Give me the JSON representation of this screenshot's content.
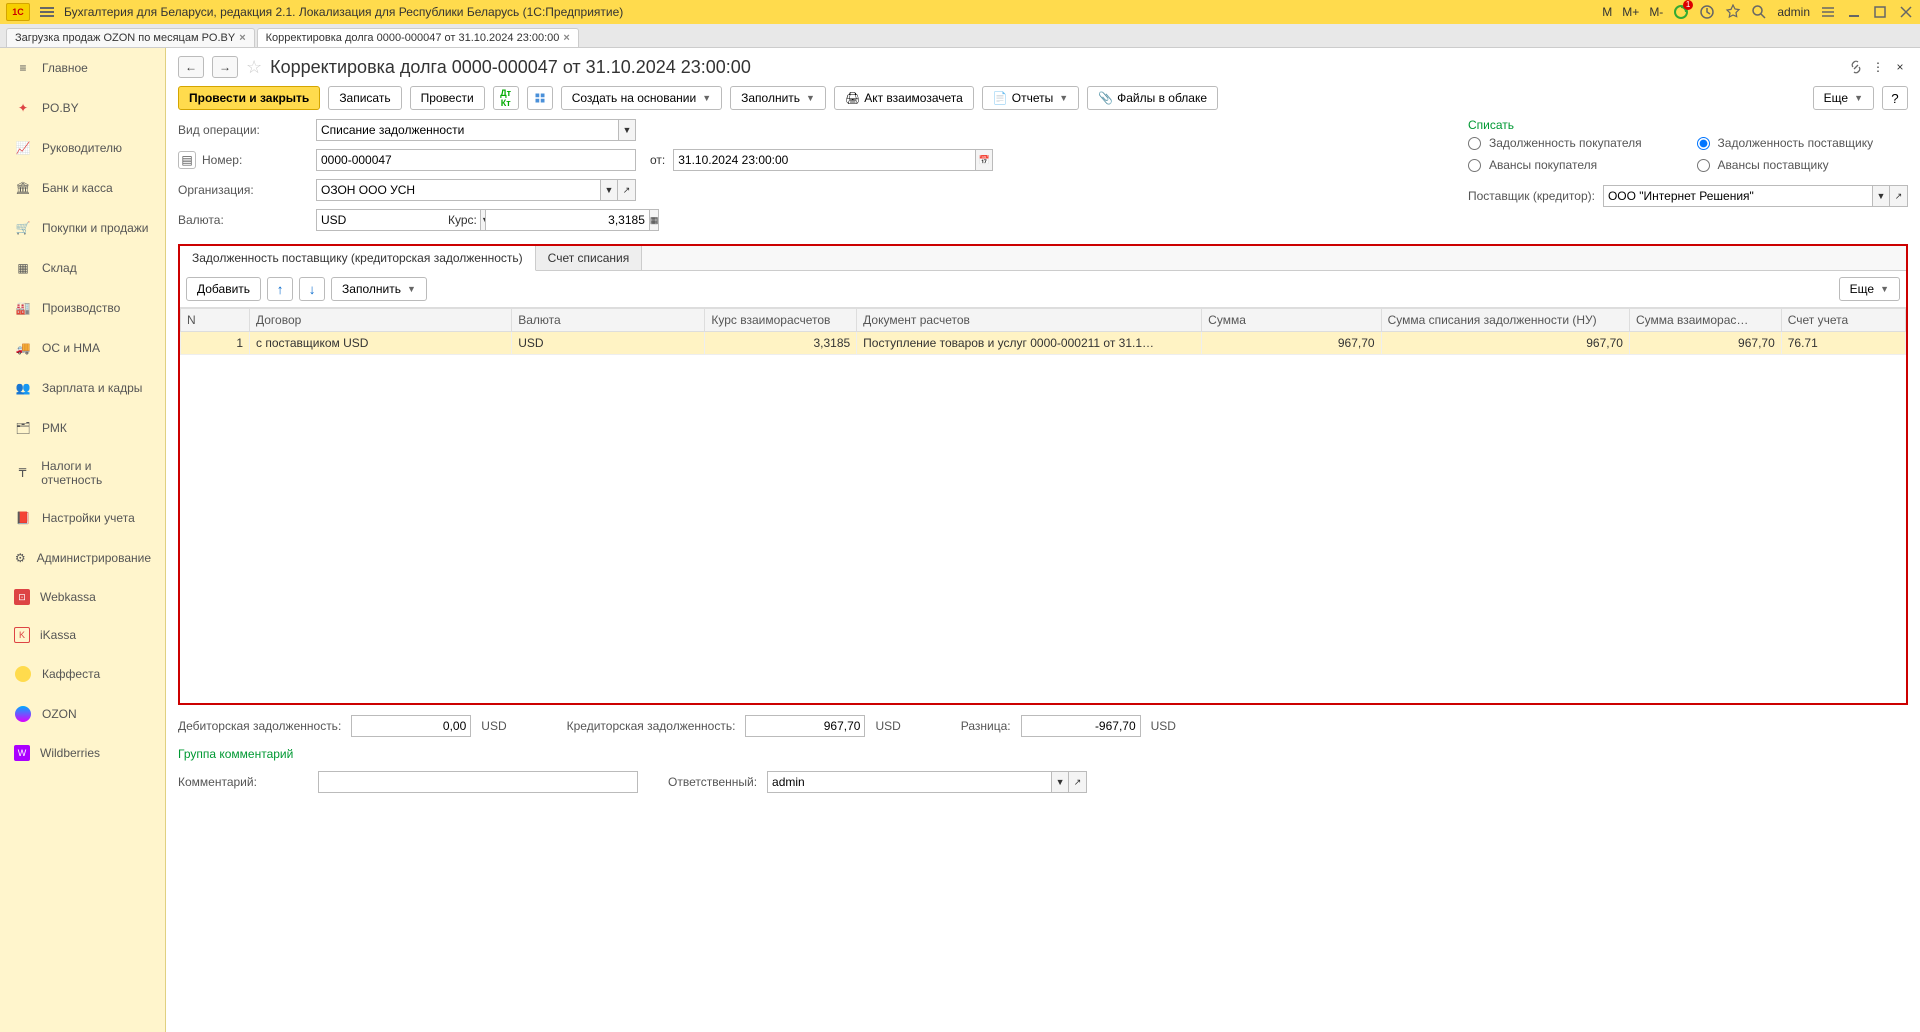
{
  "app_title": "Бухгалтерия для Беларуси, редакция 2.1. Локализация для Республики Беларусь   (1С:Предприятие)",
  "top_user": "admin",
  "top_labels": {
    "m": "M",
    "mplus": "M+",
    "mminus": "M-"
  },
  "tabs": [
    {
      "label": "Загрузка продаж OZON по месяцам PO.BY"
    },
    {
      "label": "Корректировка долга 0000-000047 от 31.10.2024 23:00:00"
    }
  ],
  "sidebar": [
    {
      "label": "Главное",
      "icon": "star"
    },
    {
      "label": "PO.BY",
      "icon": "flash"
    },
    {
      "label": "Руководителю",
      "icon": "chart"
    },
    {
      "label": "Банк и касса",
      "icon": "bank"
    },
    {
      "label": "Покупки и продажи",
      "icon": "cart"
    },
    {
      "label": "Склад",
      "icon": "boxes"
    },
    {
      "label": "Производство",
      "icon": "factory"
    },
    {
      "label": "ОС и НМА",
      "icon": "truck"
    },
    {
      "label": "Зарплата и кадры",
      "icon": "people"
    },
    {
      "label": "РМК",
      "icon": "rmk"
    },
    {
      "label": "Налоги и отчетность",
      "icon": "tax"
    },
    {
      "label": "Настройки учета",
      "icon": "book"
    },
    {
      "label": "Администрирование",
      "icon": "gear"
    },
    {
      "label": "Webkassa",
      "icon": "wk"
    },
    {
      "label": "iKassa",
      "icon": "ik"
    },
    {
      "label": "Каффеста",
      "icon": "kf"
    },
    {
      "label": "OZON",
      "icon": "oz"
    },
    {
      "label": "Wildberries",
      "icon": "wb"
    }
  ],
  "page_title": "Корректировка долга 0000-000047 от 31.10.2024 23:00:00",
  "toolbar": {
    "post_close": "Провести и закрыть",
    "save": "Записать",
    "post": "Провести",
    "create_based": "Создать на основании",
    "fill": "Заполнить",
    "act": "Акт взаимозачета",
    "reports": "Отчеты",
    "files": "Файлы в облаке",
    "more": "Еще"
  },
  "form": {
    "op_label": "Вид операции:",
    "op_value": "Списание задолженности",
    "num_label": "Номер:",
    "num_value": "0000-000047",
    "date_label": "от:",
    "date_value": "31.10.2024 23:00:00",
    "org_label": "Организация:",
    "org_value": "ОЗОН ООО УСН",
    "cur_label": "Валюта:",
    "cur_value": "USD",
    "rate_label": "Курс:",
    "rate_value": "3,3185"
  },
  "writeoff": {
    "title": "Списать",
    "r1": "Задолженность покупателя",
    "r2": "Задолженность поставщику",
    "r3": "Авансы покупателя",
    "r4": "Авансы поставщику",
    "supplier_label": "Поставщик (кредитор):",
    "supplier_value": "ООО \"Интернет Решения\""
  },
  "dtabs": {
    "t1": "Задолженность поставщику (кредиторская задолженность)",
    "t2": "Счет списания"
  },
  "dtoolbar": {
    "add": "Добавить",
    "fill": "Заполнить",
    "more": "Еще"
  },
  "dcols": {
    "n": "N",
    "contract": "Договор",
    "currency": "Валюта",
    "rate": "Курс взаиморасчетов",
    "doc": "Документ расчетов",
    "sum": "Сумма",
    "sum_nu": "Сумма списания задолженности (НУ)",
    "sum_mr": "Сумма взаиморас…",
    "account": "Счет учета"
  },
  "drow": {
    "n": "1",
    "contract": "с поставщиком USD",
    "currency": "USD",
    "rate": "3,3185",
    "doc": "Поступление товаров и услуг 0000-000211 от 31.1…",
    "sum": "967,70",
    "sum_nu": "967,70",
    "sum_mr": "967,70",
    "account": "76.71"
  },
  "footer": {
    "deb_label": "Дебиторская задолженность:",
    "deb_value": "0,00",
    "deb_cur": "USD",
    "cred_label": "Кредиторская задолженность:",
    "cred_value": "967,70",
    "cred_cur": "USD",
    "diff_label": "Разница:",
    "diff_value": "-967,70",
    "diff_cur": "USD",
    "group_comments": "Группа комментарий",
    "comment_label": "Комментарий:",
    "resp_label": "Ответственный:",
    "resp_value": "admin"
  }
}
